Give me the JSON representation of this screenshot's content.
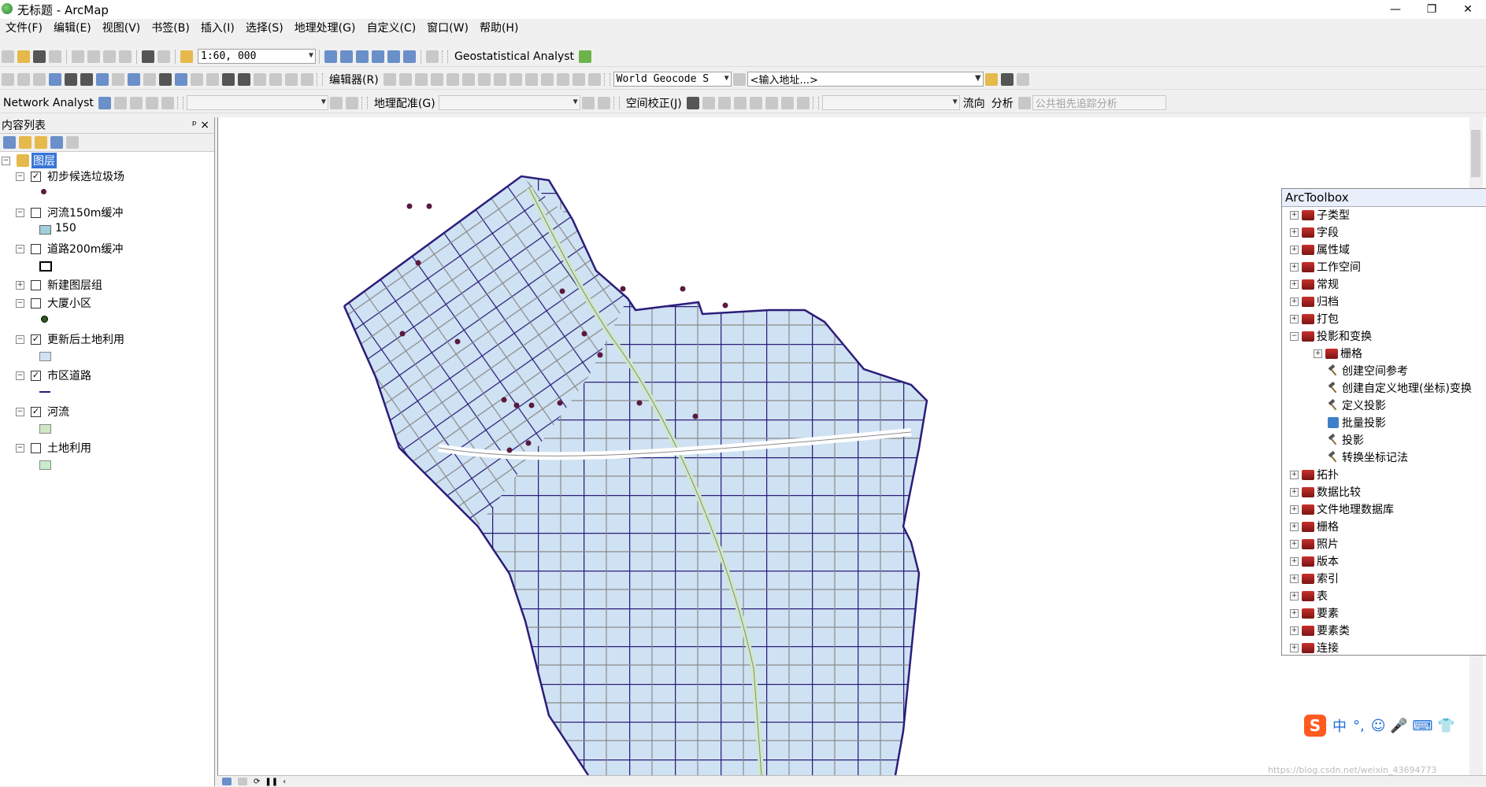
{
  "window": {
    "title": "无标题 - ArcMap",
    "buttons": [
      "—",
      "❐",
      "✕"
    ]
  },
  "menu": [
    "文件(F)",
    "编辑(E)",
    "视图(V)",
    "书签(B)",
    "插入(I)",
    "选择(S)",
    "地理处理(G)",
    "自定义(C)",
    "窗口(W)",
    "帮助(H)"
  ],
  "toolbar1": {
    "scale": "1:60, 000",
    "geostat": "Geostatistical Analyst"
  },
  "toolbar2": {
    "editor": "编辑器(R)",
    "geocode": "World Geocode S",
    "address": "<输入地址...>"
  },
  "toolbar3": {
    "network": "Network Analyst",
    "georef": "地理配准(G)",
    "spatial_adj": "空间校正(J)",
    "flow": "流向",
    "analysis": "分析",
    "trace": "公共祖先追踪分析"
  },
  "toc": {
    "header": "内容列表",
    "pin": "ᵖ ×",
    "root": "图层",
    "layers": [
      {
        "name": "初步候选垃圾场",
        "checked": true
      },
      {
        "name": "河流150m缓冲",
        "checked": false,
        "legend": "150"
      },
      {
        "name": "道路200m缓冲",
        "checked": false
      },
      {
        "name": "新建图层组",
        "checked": false
      },
      {
        "name": "大厦小区",
        "checked": false
      },
      {
        "name": "更新后土地利用",
        "checked": true
      },
      {
        "name": "市区道路",
        "checked": true
      },
      {
        "name": "河流",
        "checked": true
      },
      {
        "name": "土地利用",
        "checked": false
      }
    ]
  },
  "toolbox": {
    "title": "ArcToolbox",
    "items": [
      {
        "label": "子类型",
        "level": 0,
        "exp": "+"
      },
      {
        "label": "字段",
        "level": 0,
        "exp": "+"
      },
      {
        "label": "属性域",
        "level": 0,
        "exp": "+"
      },
      {
        "label": "工作空间",
        "level": 0,
        "exp": "+"
      },
      {
        "label": "常规",
        "level": 0,
        "exp": "+"
      },
      {
        "label": "归档",
        "level": 0,
        "exp": "+"
      },
      {
        "label": "打包",
        "level": 0,
        "exp": "+"
      },
      {
        "label": "投影和变换",
        "level": 0,
        "exp": "−"
      },
      {
        "label": "栅格",
        "level": 1,
        "exp": "+"
      },
      {
        "label": "创建空间参考",
        "level": 2,
        "exp": ""
      },
      {
        "label": "创建自定义地理(坐标)变换",
        "level": 2,
        "exp": ""
      },
      {
        "label": "定义投影",
        "level": 2,
        "exp": ""
      },
      {
        "label": "批量投影",
        "level": 2,
        "exp": "",
        "script": true
      },
      {
        "label": "投影",
        "level": 2,
        "exp": ""
      },
      {
        "label": "转换坐标记法",
        "level": 2,
        "exp": ""
      },
      {
        "label": "拓扑",
        "level": 0,
        "exp": "+"
      },
      {
        "label": "数据比较",
        "level": 0,
        "exp": "+"
      },
      {
        "label": "文件地理数据库",
        "level": 0,
        "exp": "+"
      },
      {
        "label": "栅格",
        "level": 0,
        "exp": "+"
      },
      {
        "label": "照片",
        "level": 0,
        "exp": "+"
      },
      {
        "label": "版本",
        "level": 0,
        "exp": "+"
      },
      {
        "label": "索引",
        "level": 0,
        "exp": "+"
      },
      {
        "label": "表",
        "level": 0,
        "exp": "+"
      },
      {
        "label": "要素",
        "level": 0,
        "exp": "+"
      },
      {
        "label": "要素类",
        "level": 0,
        "exp": "+"
      },
      {
        "label": "连接",
        "level": 0,
        "exp": "+"
      }
    ]
  },
  "ime": {
    "logo": "S",
    "lang": "中",
    "punct": "°,",
    "icons": "☺ 🎤 ⌨ 👕"
  },
  "watermark": "https://blog.csdn.net/weixin_43694773",
  "colors": {
    "parcel": "#cfe2f3",
    "road": "#2b1d7a",
    "minor_road": "#8a8a8a",
    "river": "#cfe8c4",
    "candidate": "#5a1a3f"
  }
}
